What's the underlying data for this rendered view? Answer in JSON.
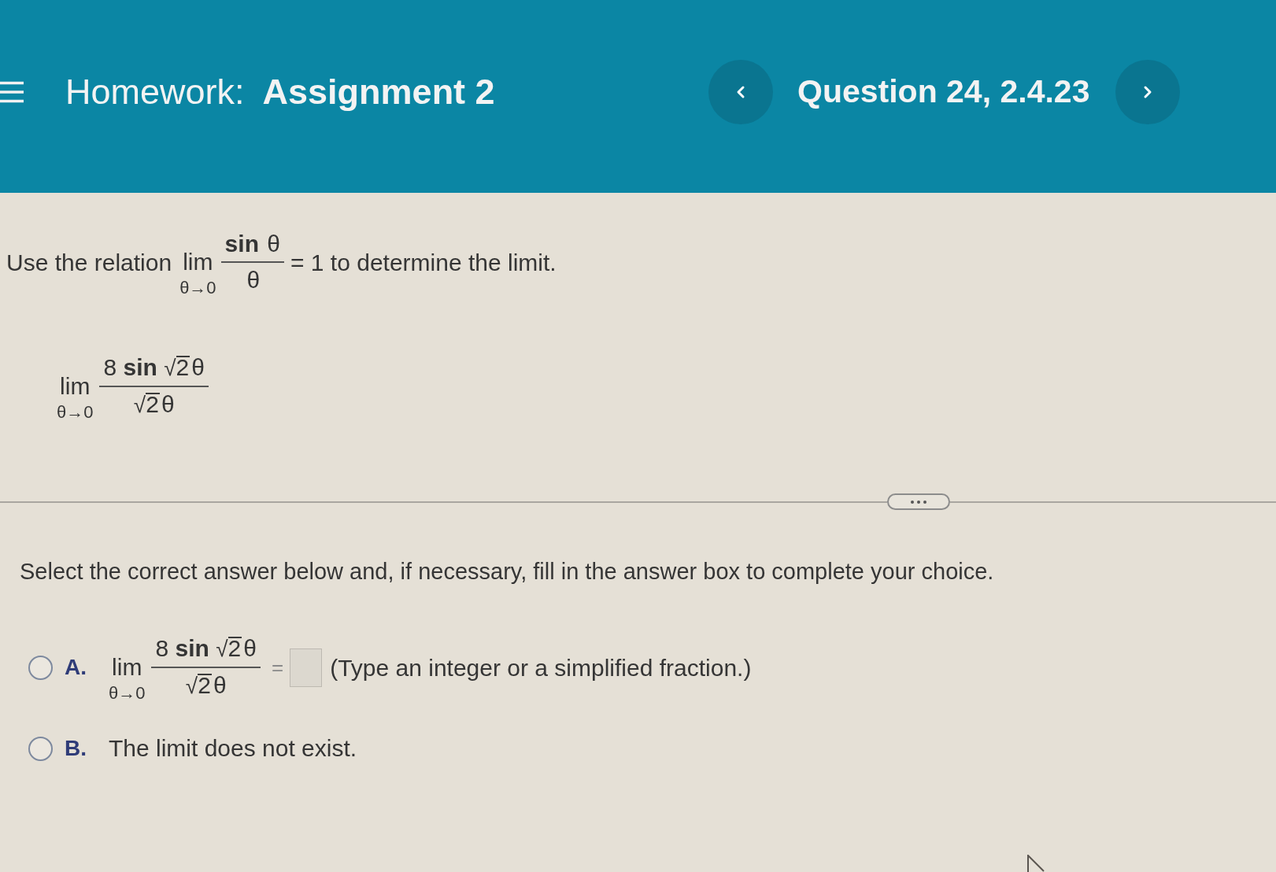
{
  "header": {
    "label": "Homework:",
    "title": "Assignment 2",
    "question": "Question 24, 2.4.23"
  },
  "problem": {
    "relation": {
      "before": "Use the relation",
      "limit": {
        "lim": "lim",
        "under": "θ→0"
      },
      "numerator": {
        "function": "sin",
        "variable": "θ"
      },
      "denominator": {
        "variable": "θ"
      },
      "after": "= 1 to determine the limit."
    },
    "expression": {
      "limit": {
        "lim": "lim",
        "under": "θ→0"
      },
      "numerator": {
        "coefficient": "8",
        "function": "sin",
        "radical": "√",
        "radicand": "2",
        "variable": "θ"
      },
      "denominator": {
        "radical": "√",
        "radicand": "2",
        "variable": "θ"
      }
    }
  },
  "instruction": "Select the correct answer below and, if necessary, fill in the answer box to complete your choice.",
  "options": [
    {
      "kind": "expression",
      "letter": "A.",
      "selected": false,
      "expression": {
        "limit": {
          "lim": "lim",
          "under": "θ→0"
        },
        "numerator": {
          "coefficient": "8",
          "function": "sin",
          "radical": "√",
          "radicand": "2",
          "variable": "θ"
        },
        "denominator": {
          "radical": "√",
          "radicand": "2",
          "variable": "θ"
        }
      },
      "equals": "=",
      "hint": "(Type an integer or a simplified fraction.)"
    },
    {
      "kind": "text",
      "letter": "B.",
      "selected": false,
      "text": "The limit does not exist."
    }
  ]
}
